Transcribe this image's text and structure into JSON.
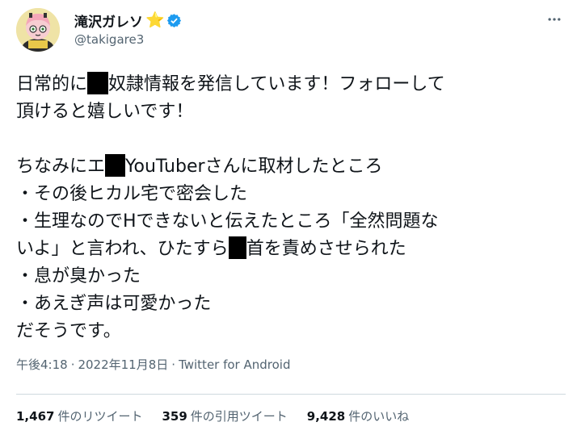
{
  "author": {
    "display_name": "滝沢ガレソ",
    "handle": "@takigare3",
    "badge_emoji": "⭐"
  },
  "tweet": {
    "lines": [
      [
        "日常的に",
        "奴隷情報を発信しています！フォローして"
      ],
      [
        "頂けると嬉しいです！"
      ],
      [],
      [
        "ちなみにエ",
        "YouTuberさんに取材したところ"
      ],
      [
        "・その後ヒカル宅で密会した"
      ],
      [
        "・生理なのでHできないと伝えたところ「全然問題な"
      ],
      [
        "いよ」と言われ、ひたすら",
        "首を責めさせられた"
      ],
      [
        "・息が臭かった"
      ],
      [
        "・あえぎ声は可愛かった"
      ],
      [
        "だそうです。"
      ]
    ]
  },
  "meta": {
    "time": "午後4:18",
    "separator": "·",
    "date": "2022年11月8日",
    "source": "Twitter for Android"
  },
  "stats": {
    "retweets_count": "1,467",
    "retweets_label": "件のリツイート",
    "quotes_count": "359",
    "quotes_label": "件の引用ツイート",
    "likes_count": "9,428",
    "likes_label": "件のいいね"
  },
  "colors": {
    "text": "#0f1419",
    "secondary": "#536471",
    "verified": "#1d9bf0",
    "star": "#f5a623",
    "divider": "#cfd9de"
  }
}
